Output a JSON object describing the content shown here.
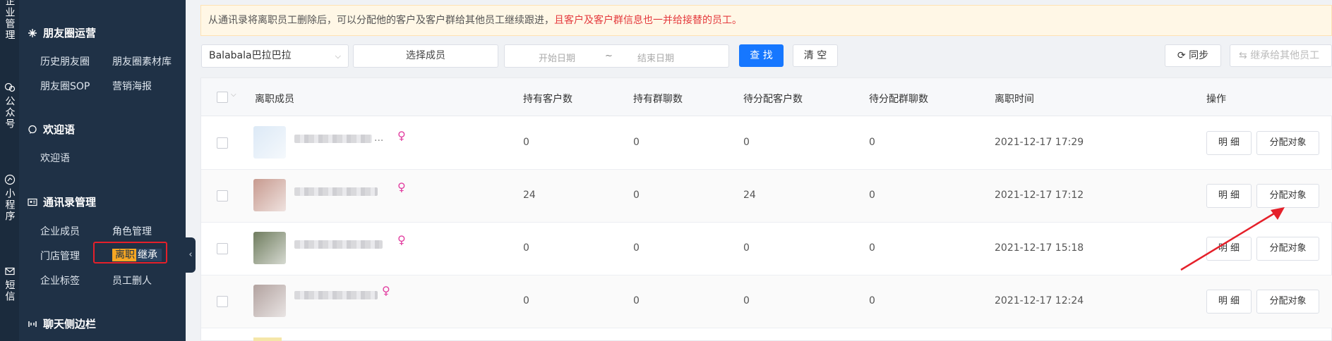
{
  "rail": [
    {
      "label": "企业管理",
      "icon": "building-icon"
    },
    {
      "label": "公众号",
      "icon": "wechat-icon"
    },
    {
      "label": "小程序",
      "icon": "miniprogram-icon"
    },
    {
      "label": "短信",
      "icon": "mail-icon"
    }
  ],
  "menu": {
    "moments": {
      "title": "朋友圈运营",
      "items": [
        "历史朋友圈",
        "朋友圈素材库",
        "朋友圈SOP",
        "营销海报"
      ]
    },
    "welcome": {
      "title": "欢迎语",
      "items": [
        "欢迎语"
      ]
    },
    "contacts": {
      "title": "通讯录管理",
      "items": [
        "企业成员",
        "角色管理",
        "门店管理",
        "离职",
        "继承",
        "企业标签",
        "员工删人"
      ]
    },
    "chatbar": {
      "title": "聊天侧边栏"
    }
  },
  "notice": {
    "text": "从通讯录将离职员工删除后，可以分配他的客户及客户群给其他员工继续跟进，",
    "warning": "且客户及客户群信息也一并给接替的员工。"
  },
  "filters": {
    "company": "Balabala巴拉巴拉",
    "member": "选择成员",
    "start_date": "开始日期",
    "separator": "~",
    "end_date": "结束日期",
    "search": "查 找",
    "clear": "清 空",
    "sync": "同步",
    "transfer": "继承给其他员工"
  },
  "table": {
    "columns": [
      "离职成员",
      "持有客户数",
      "持有群聊数",
      "待分配客户数",
      "待分配群聊数",
      "离职时间",
      "操作"
    ],
    "rows": [
      {
        "name_suffix": "...",
        "customers": "0",
        "groups": "0",
        "pending_customers": "0",
        "pending_groups": "0",
        "time": "2021-12-17 17:29",
        "avatar_color": "#dce9f6"
      },
      {
        "name_suffix": "",
        "customers": "24",
        "groups": "0",
        "pending_customers": "24",
        "pending_groups": "0",
        "time": "2021-12-17 17:12",
        "avatar_color": "#c79a8f"
      },
      {
        "name_suffix": "",
        "customers": "0",
        "groups": "0",
        "pending_customers": "0",
        "pending_groups": "0",
        "time": "2021-12-17 15:18",
        "avatar_color": "#6f7c5e"
      },
      {
        "name_suffix": "",
        "customers": "0",
        "groups": "0",
        "pending_customers": "0",
        "pending_groups": "0",
        "time": "2021-12-17 12:24",
        "avatar_color": "#b2a29f"
      }
    ],
    "detail_label": "明 细",
    "assign_label": "分配对象",
    "gender_symbol": "♀"
  },
  "colors": {
    "accent": "#1677ff",
    "warning": "#e4393c",
    "annotation": "#e5202a",
    "active_menu": "#f5a623"
  }
}
